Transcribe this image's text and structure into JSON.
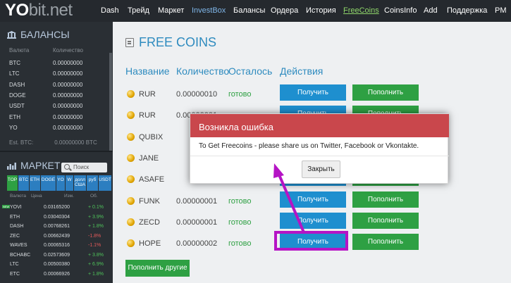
{
  "brand": {
    "yo": "YO",
    "bit": "bit.net"
  },
  "nav": [
    "Dash",
    "Трейд",
    "Маркет",
    "InvestBox",
    "Балансы",
    "Ордера",
    "История",
    "FreeCoins",
    "CoinsInfo",
    "Add",
    "Поддержка",
    "PM"
  ],
  "balances": {
    "title": "БАЛАНСЫ",
    "col_currency": "Валюта",
    "col_amount": "Количество",
    "rows": [
      {
        "c": "BTC",
        "v": "0.00000000"
      },
      {
        "c": "LTC",
        "v": "0.00000000"
      },
      {
        "c": "DASH",
        "v": "0.00000000"
      },
      {
        "c": "DOGE",
        "v": "0.00000000"
      },
      {
        "c": "USDT",
        "v": "0.00000000"
      },
      {
        "c": "ETH",
        "v": "0.00000000"
      },
      {
        "c": "YO",
        "v": "0.00000000"
      }
    ],
    "est_label": "Est. BTC:",
    "est_value": "0.00000000 BTC"
  },
  "market": {
    "title": "МАРКЕТ",
    "search_placeholder": "Поиск",
    "tabs": [
      "TOP",
      "BTC",
      "ETH",
      "DOGE",
      "YO",
      "W",
      "долл США",
      "руб",
      "USDT"
    ],
    "col_currency": "Валюта",
    "col_price": "Цена",
    "col_change": "Изм.",
    "col_volume": "Об.",
    "badge": "NEW",
    "rows": [
      {
        "n": "YOVI",
        "p": "0.03165200",
        "ch": "+ 0.1%",
        "dir": "up"
      },
      {
        "n": "ETH",
        "p": "0.03040304",
        "ch": "+ 3.9%",
        "dir": "up"
      },
      {
        "n": "DASH",
        "p": "0.00768261",
        "ch": "+ 1.8%",
        "dir": "up"
      },
      {
        "n": "ZEC",
        "p": "0.00662439",
        "ch": "-1.8%",
        "dir": "down"
      },
      {
        "n": "WAVES",
        "p": "0.00065316",
        "ch": "-1.1%",
        "dir": "down"
      },
      {
        "n": "BCHABC",
        "p": "0.02573609",
        "ch": "+ 3.8%",
        "dir": "up"
      },
      {
        "n": "LTC",
        "p": "0.00500380",
        "ch": "+ 6.9%",
        "dir": "up"
      },
      {
        "n": "ETC",
        "p": "0.00066926",
        "ch": "+ 1.8%",
        "dir": "up"
      }
    ]
  },
  "page": {
    "title": "FREE COINS",
    "headers": {
      "name": "Название",
      "qty": "Количество",
      "left": "Осталось",
      "actions": "Действия"
    },
    "get_label": "Получить",
    "add_label": "Пополнить",
    "more_label": "Пополнить другие",
    "rows": [
      {
        "name": "RUR",
        "qty": "0.00000010",
        "status": "готово"
      },
      {
        "name": "RUR",
        "qty": "0.00000001",
        "status": "готово"
      },
      {
        "name": "QUBIX",
        "qty": "",
        "status": ""
      },
      {
        "name": "JANE",
        "qty": "",
        "status": ""
      },
      {
        "name": "ASAFE",
        "qty": "",
        "status": ""
      },
      {
        "name": "FUNK",
        "qty": "0.00000001",
        "status": "готово"
      },
      {
        "name": "ZECD",
        "qty": "0.00000001",
        "status": "готово"
      },
      {
        "name": "HOPE",
        "qty": "0.00000002",
        "status": "готово"
      }
    ]
  },
  "modal": {
    "title": "Возникла ошибка",
    "message": "To Get Freecoins - please share us on Twitter, Facebook or Vkontakte.",
    "close_label": "Закрыть"
  },
  "colors": {
    "accent": "#2e8bbf",
    "green": "#2ea043",
    "blue": "#1e8fcf",
    "danger": "#c9474c",
    "highlight": "#b514c5"
  }
}
